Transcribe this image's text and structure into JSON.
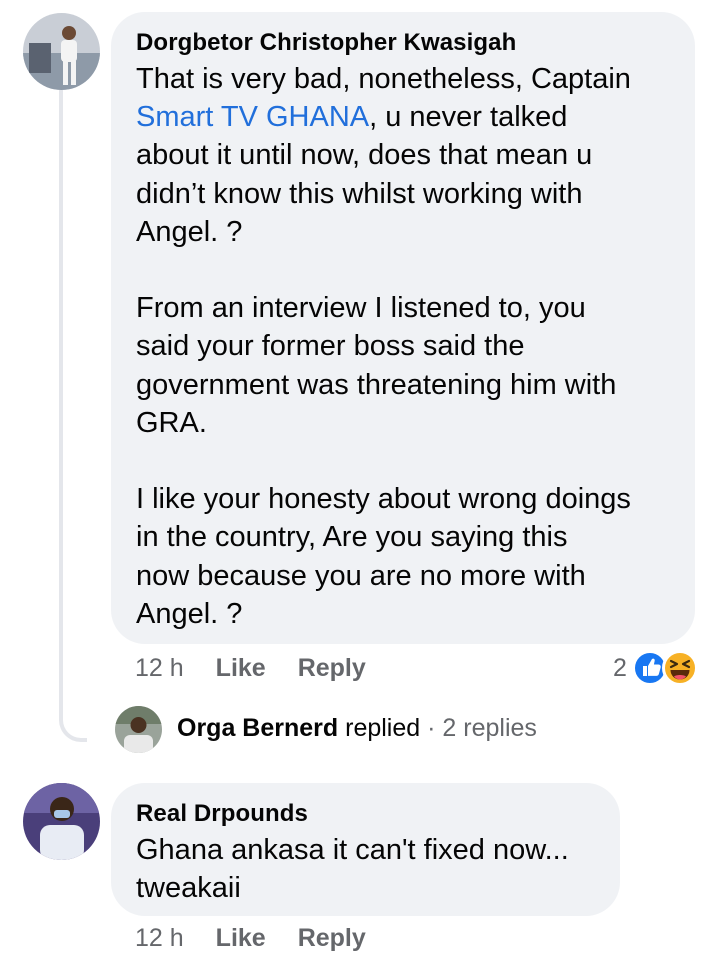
{
  "comment1": {
    "author": "Dorgbetor Christopher Kwasigah",
    "paragraphs": [
      [
        "That is very bad, nonetheless, Captain",
        "@Smart TV GHANA",
        ", u never talked",
        "about it until now, does that mean u",
        "didn’t know this whilst working with",
        "Angel. ?"
      ],
      [
        "From an interview I listened to, you",
        "said your former boss said the",
        "government was threatening him with",
        "GRA."
      ],
      [
        "I like your honesty about wrong doings",
        "in the country,   Are you saying this",
        "now because you are no more with",
        "Angel. ?"
      ]
    ],
    "line1_prefix": "That is very bad, nonetheless, Captain",
    "mention": "Smart TV GHANA",
    "line2_suffix": ", u never talked",
    "line3": "about it until now, does that mean u",
    "line4": "didn’t know this whilst working with",
    "line5": "Angel. ?",
    "p2": [
      "From an interview I listened to, you",
      "said your former boss said the",
      "government was threatening him with",
      "GRA."
    ],
    "p3": [
      "I like your honesty about wrong doings",
      "in the country,   Are you saying this",
      "now because you are no more with",
      "Angel. ?"
    ],
    "time": "12 h",
    "like_label": "Like",
    "reply_label": "Reply",
    "reaction_count": "2",
    "reactions": [
      "like-icon",
      "haha-icon"
    ]
  },
  "reply_summary": {
    "name": "Orga Bernerd",
    "verb": "replied",
    "separator": "·",
    "count_text": "2 replies"
  },
  "comment2": {
    "author": "Real Drpounds",
    "lines": [
      "Ghana ankasa it can't fixed now...",
      "tweakaii"
    ],
    "time": "12 h",
    "like_label": "Like",
    "reply_label": "Reply"
  },
  "colors": {
    "bubble": "#f0f2f5",
    "mention": "#216fdb",
    "muted": "#65676b",
    "like_blue": "#1877f2",
    "haha_yellow": "#f7b125"
  }
}
